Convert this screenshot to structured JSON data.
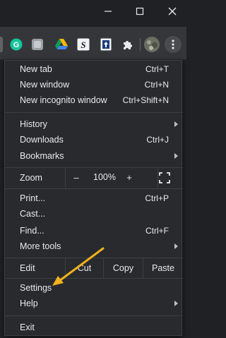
{
  "colors": {
    "window_bg": "#202124",
    "toolbar_bg": "#35363a",
    "menu_bg": "#292a2d",
    "separator": "#3c4043",
    "text": "#e8eaed",
    "annotation_arrow": "#f2b21e",
    "grammarly_green": "#15c39a"
  },
  "window_controls": {
    "minimize_icon": "minimize-icon",
    "maximize_icon": "maximize-icon",
    "close_icon": "close-icon"
  },
  "toolbar": {
    "extensions": [
      {
        "name": "grammarly-extension-icon",
        "glyph": "G"
      },
      {
        "name": "generic-extension-icon",
        "glyph": ""
      },
      {
        "name": "google-drive-icon",
        "glyph": ""
      },
      {
        "name": "s-extension-icon",
        "glyph": "S"
      },
      {
        "name": "page-upload-extension-icon",
        "glyph": ""
      },
      {
        "name": "puzzle-extensions-icon",
        "glyph": ""
      },
      {
        "name": "profile-avatar",
        "glyph": ""
      },
      {
        "name": "kebab-menu-icon",
        "glyph": ""
      }
    ]
  },
  "menu": {
    "new_tab": {
      "label": "New tab",
      "shortcut": "Ctrl+T"
    },
    "new_window": {
      "label": "New window",
      "shortcut": "Ctrl+N"
    },
    "new_incognito": {
      "label": "New incognito window",
      "shortcut": "Ctrl+Shift+N"
    },
    "history": {
      "label": "History"
    },
    "downloads": {
      "label": "Downloads",
      "shortcut": "Ctrl+J"
    },
    "bookmarks": {
      "label": "Bookmarks"
    },
    "zoom": {
      "label": "Zoom",
      "minus": "–",
      "value": "100%",
      "plus": "+",
      "fullscreen_icon": "fullscreen-icon"
    },
    "print": {
      "label": "Print...",
      "shortcut": "Ctrl+P"
    },
    "cast": {
      "label": "Cast..."
    },
    "find": {
      "label": "Find...",
      "shortcut": "Ctrl+F"
    },
    "more_tools": {
      "label": "More tools"
    },
    "edit": {
      "label": "Edit",
      "cut": "Cut",
      "copy": "Copy",
      "paste": "Paste"
    },
    "settings": {
      "label": "Settings"
    },
    "help": {
      "label": "Help"
    },
    "exit": {
      "label": "Exit"
    }
  }
}
